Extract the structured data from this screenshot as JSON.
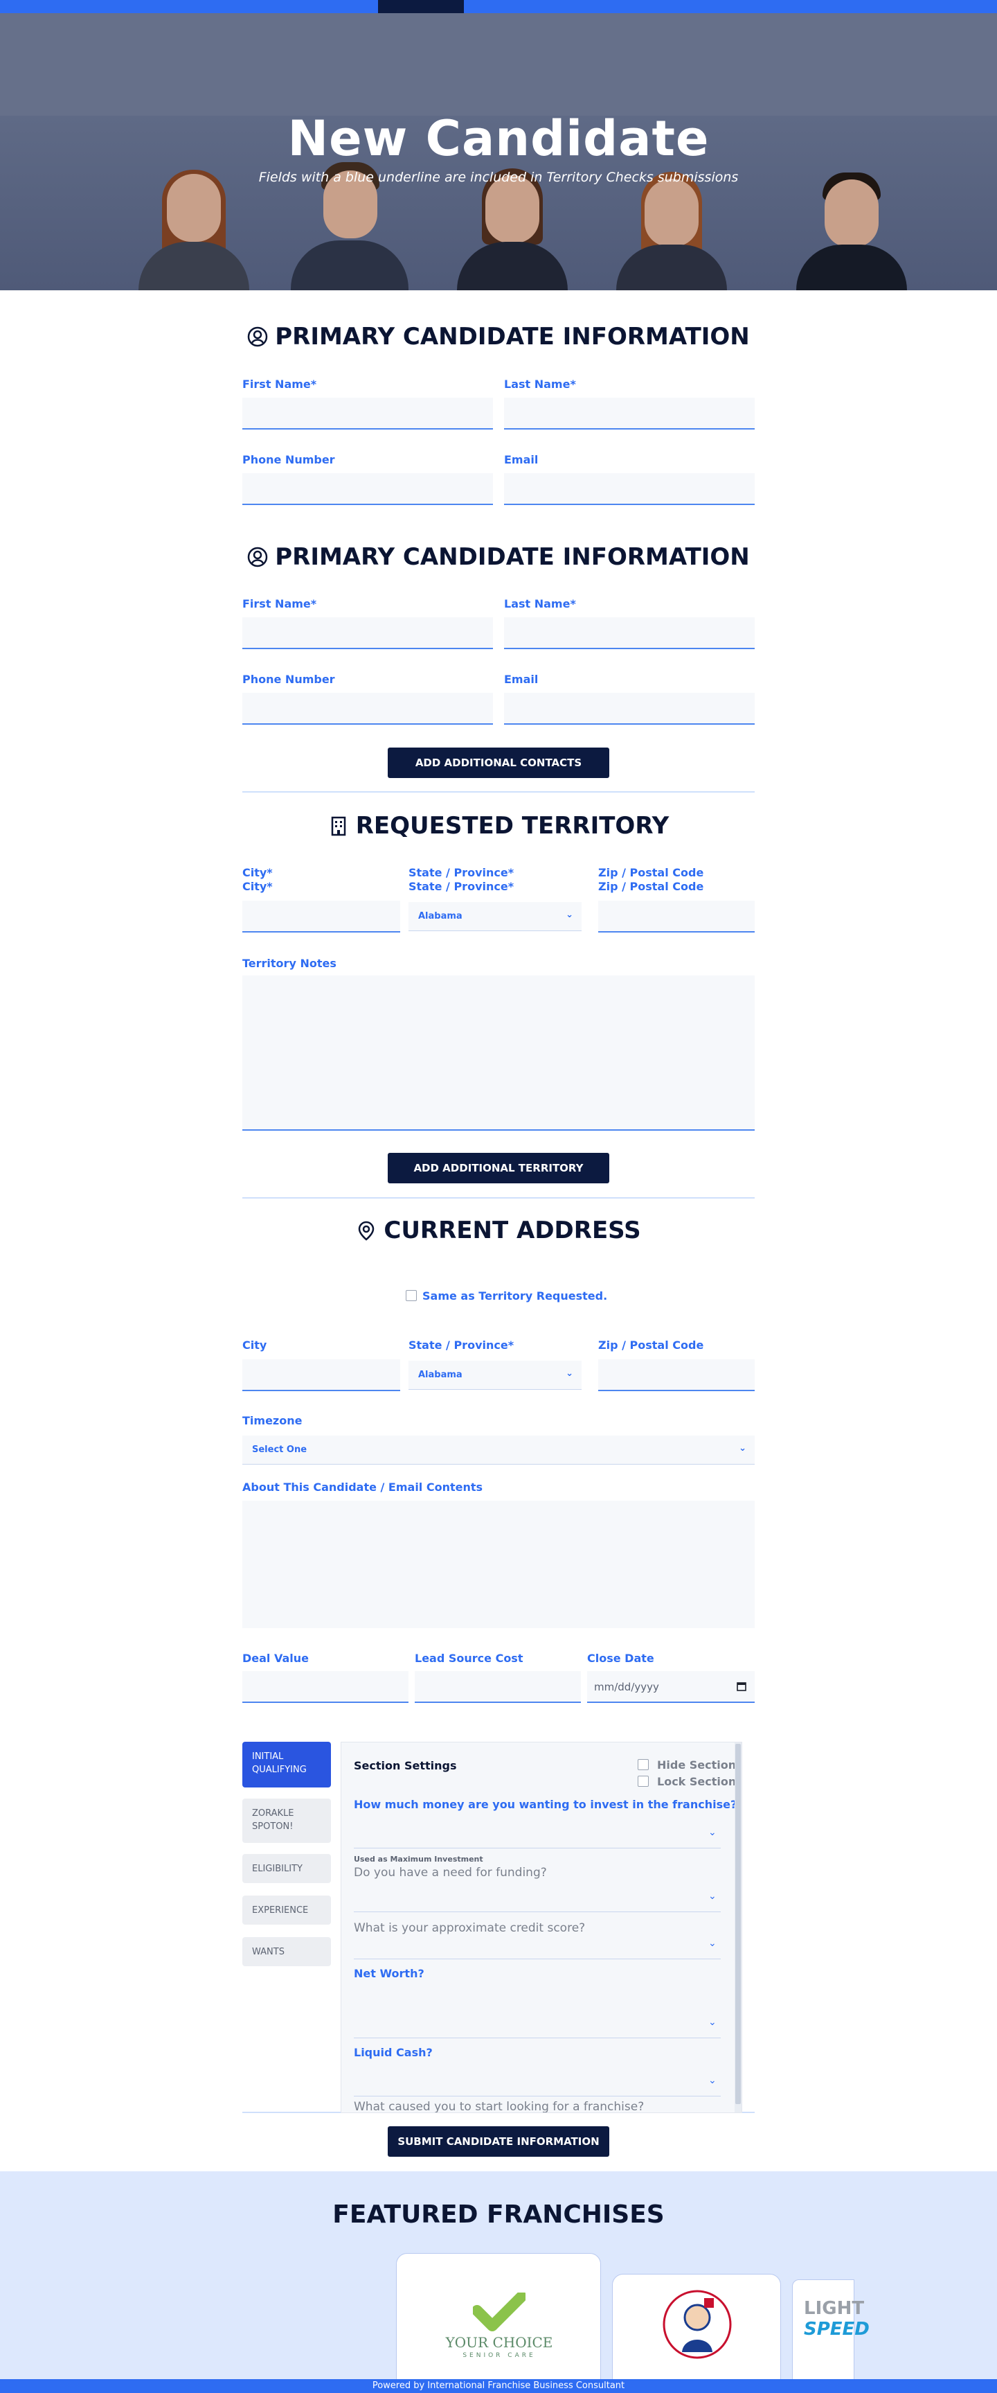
{
  "hero": {
    "title": "New Candidate",
    "subtitle": "Fields with a blue underline are included in Territory Checks submissions"
  },
  "primary1": {
    "title": "PRIMARY CANDIDATE INFORMATION",
    "first_name": "First Name*",
    "last_name": "Last Name*",
    "phone": "Phone Number",
    "email": "Email"
  },
  "primary2": {
    "title": "PRIMARY CANDIDATE INFORMATION",
    "first_name": "First Name*",
    "last_name": "Last Name*",
    "phone": "Phone Number",
    "email": "Email",
    "add_button": "ADD ADDITIONAL CONTACTS"
  },
  "territory": {
    "title": "REQUESTED TERRITORY",
    "city": "City*",
    "state": "State / Province*",
    "zip": "Zip / Postal Code",
    "state_value": "Alabama",
    "notes": "Territory Notes",
    "add_button": "ADD ADDITIONAL TERRITORY"
  },
  "address": {
    "title": "CURRENT ADDRESS",
    "same_as": "Same as Territory Requested.",
    "city": "City",
    "state": "State / Province*",
    "zip": "Zip / Postal Code",
    "state_value": "Alabama",
    "timezone": "Timezone",
    "timezone_value": "Select One",
    "about": "About This Candidate / Email Contents",
    "deal_value": "Deal Value",
    "lead_cost": "Lead Source Cost",
    "close_date": "Close Date",
    "close_date_placeholder": "mm/dd/yyyy"
  },
  "qualifying": {
    "tabs": [
      "INITIAL QUALIFYING",
      "ZORAKLE SPOTON!",
      "ELIGIBILITY",
      "EXPERIENCE",
      "WANTS"
    ],
    "section_settings": "Section Settings",
    "hide_section": "Hide Section",
    "lock_section": "Lock Section",
    "q1": "How much money are you wanting to invest in the franchise?",
    "q1_note": "Used as Maximum Investment",
    "q2": "Do you have a need for funding?",
    "q3": "What is your approximate credit score?",
    "q4": "Net Worth?",
    "q5": "Liquid Cash?",
    "q6": "What caused you to start looking for a franchise?"
  },
  "submit_button": "SUBMIT CANDIDATE INFORMATION",
  "featured": {
    "title": "FEATURED FRANCHISES",
    "card1_brand": "YOUR CHOICE",
    "card1_sub": "SENIOR CARE",
    "card3_brand_top": "LIGHT",
    "card3_brand_bottom": "SPEED"
  },
  "footer": "Powered by International Franchise Business Consultant",
  "colors": {
    "accent": "#2e6cf2",
    "navy": "#0c1a40"
  }
}
